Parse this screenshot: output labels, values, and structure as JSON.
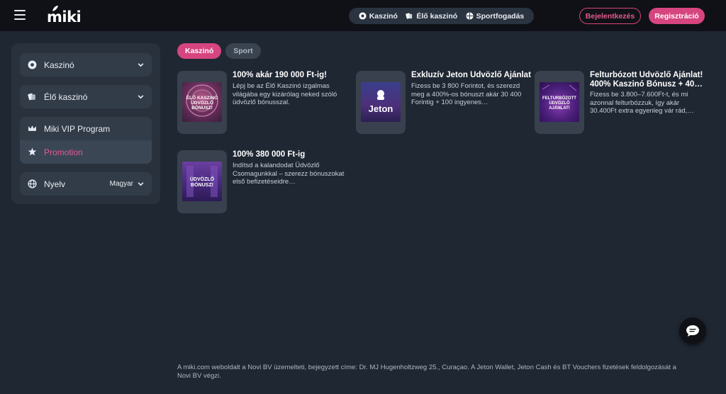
{
  "header": {
    "logo": "miki",
    "nav": [
      {
        "label": "Kaszinó",
        "icon": "casino-chip-icon"
      },
      {
        "label": "Élő kaszinó",
        "icon": "card-icon"
      },
      {
        "label": "Sportfogadás",
        "icon": "ball-icon"
      }
    ],
    "login_label": "Bejelentkezés",
    "register_label": "Regisztráció"
  },
  "sidebar": {
    "items": [
      {
        "label": "Kaszinó",
        "icon": "casino-chip-icon"
      },
      {
        "label": "Élő kaszinó",
        "icon": "card-icon"
      },
      {
        "label": "Miki VIP Program",
        "icon": "crown-icon"
      },
      {
        "label": "Promotion",
        "icon": "star-badge-icon"
      },
      {
        "label": "Nyelv",
        "icon": "globe-icon",
        "value": "Magyar"
      }
    ]
  },
  "tabs": [
    {
      "label": "Kaszinó",
      "active": true
    },
    {
      "label": "Sport",
      "active": false
    }
  ],
  "promos": [
    {
      "title": "100% akár 190 000 Ft-ig!",
      "description": "Lépj be az Élő Kaszinó izgalmas világába egy kizárólag neked szóló üdvözlő bónusszal.",
      "image_text": "ÉLŐ KASZINÓ ÜDVÖZLŐ BÓNUSZ!"
    },
    {
      "title": "Exkluzív Jeton Üdvözlő Ajánlat",
      "description": "Fizess be 3 800 Forintot, és szerezd meg a 400%-os bónuszt akár 30 400 Forintig + 100 ingyenes…",
      "image_text": "Jeton"
    },
    {
      "title": "Felturbózott Üdvözlő Ajánlat! 400% Kaszinó Bónusz + 40…",
      "description": "Fizess be 3.800–7.600Ft-t, és mi azonnal felturbózzuk, így akár 30.400Ft extra egyenleg vár rád,…",
      "image_text": "FELTURBÓZOTT ÜDVÖZLŐ AJÁNLAT!"
    },
    {
      "title": "100% 380 000 Ft-ig",
      "description": "Indítsd a kalandodat Üdvözlő Csomagunkkal – szerezz bónuszokat első befizetéseidre…",
      "image_text": "ÜDVÖZLŐ BÓNUSZ!"
    }
  ],
  "footer": {
    "text": "A miki.com weboldalt a Novi BV üzemelteti, bejegyzett címe: Dr. MJ Hugenholtzweg 25., Curaçao. A Jeton Wallet, Jeton Cash és BT Vouchers fizetések feldolgozását a Novi BV végzi."
  },
  "colors": {
    "accent": "#d6457f",
    "header_bg": "#0f1116",
    "page_bg": "#1f2733",
    "card_bg": "#29313d"
  }
}
